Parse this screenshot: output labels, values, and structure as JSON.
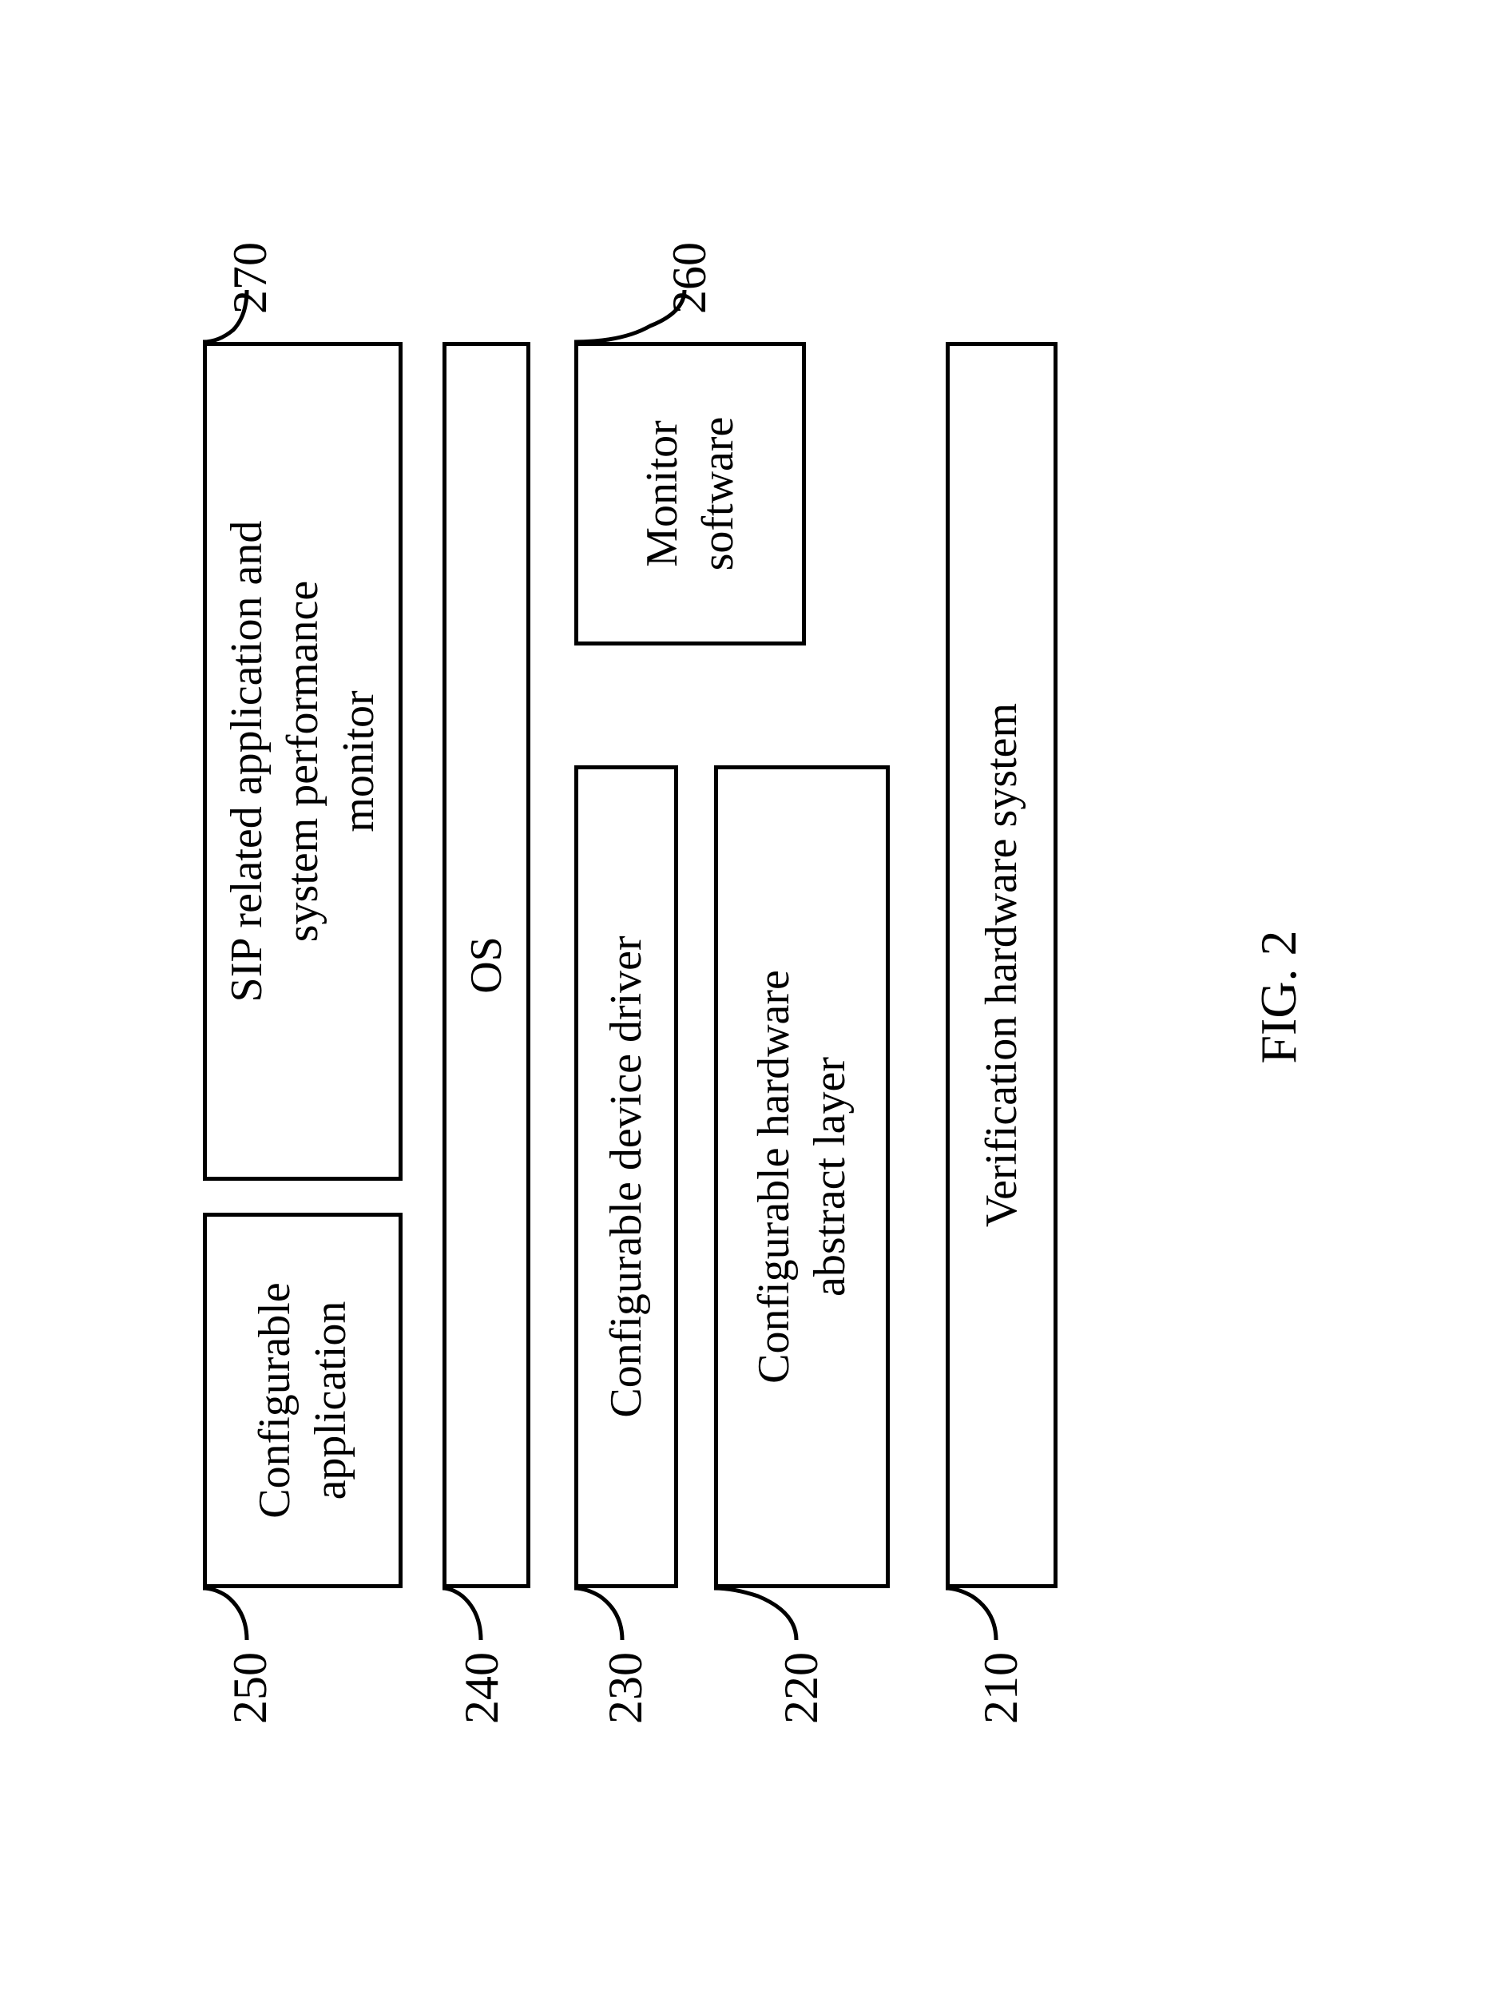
{
  "labels": {
    "l250": "250",
    "l270": "270",
    "l240": "240",
    "l230": "230",
    "l260": "260",
    "l220": "220",
    "l210": "210"
  },
  "boxes": {
    "configApp": "Configurable\napplication",
    "sipMonitor": "SIP related application and\nsystem performance\nmonitor",
    "os": "OS",
    "deviceDriver": "Configurable device driver",
    "monitorSw": "Monitor\nsoftware",
    "hwAbstract": "Configurable hardware\nabstract layer",
    "verifHw": "Verification hardware system"
  },
  "caption": "FIG. 2"
}
